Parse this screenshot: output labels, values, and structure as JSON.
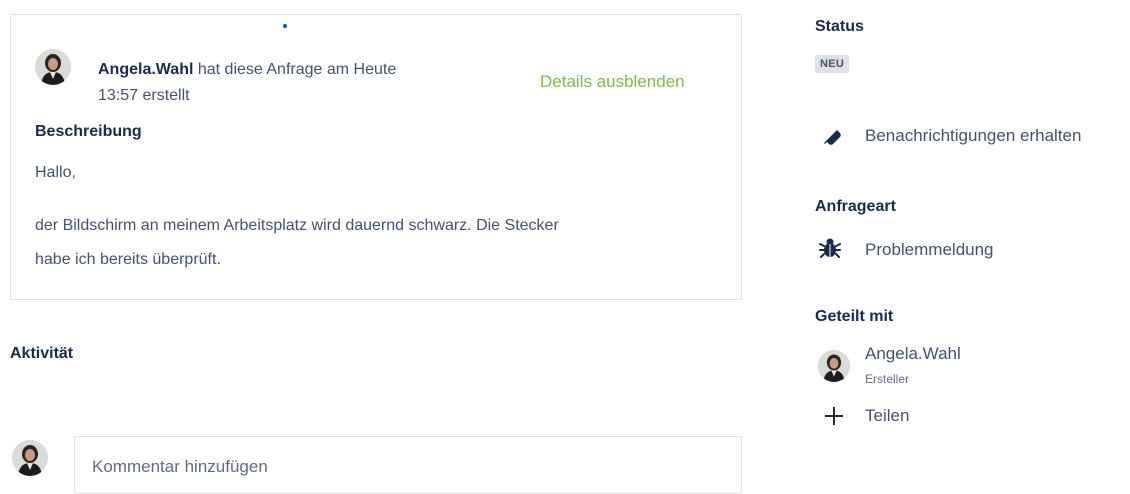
{
  "request": {
    "creator_name": "Angela.Wahl",
    "created_text_1": " hat diese Anfrage am Heute",
    "created_text_2": "13:57 erstellt",
    "details_toggle": "Details ausblenden",
    "description_title": "Beschreibung",
    "description_line_1": "Hallo,",
    "description_line_2": "der Bildschirm an meinem Arbeitsplatz wird dauernd schwarz. Die Stecker",
    "description_line_3": "habe ich bereits überprüft."
  },
  "activity": {
    "title": "Aktivität",
    "comment_placeholder": "Kommentar hinzufügen"
  },
  "sidebar": {
    "status_title": "Status",
    "status_value": "NEU",
    "notifications_label": "Benachrichtigungen erhalten",
    "request_type_title": "Anfrageart",
    "request_type_value": "Problemmeldung",
    "shared_title": "Geteilt mit",
    "shared_user_name": "Angela.Wahl",
    "shared_user_role": "Ersteller",
    "share_label": "Teilen"
  },
  "colors": {
    "link_green": "#7bc043",
    "heading": "#172b4d",
    "text": "#42526e",
    "border": "#dfe1e6"
  }
}
